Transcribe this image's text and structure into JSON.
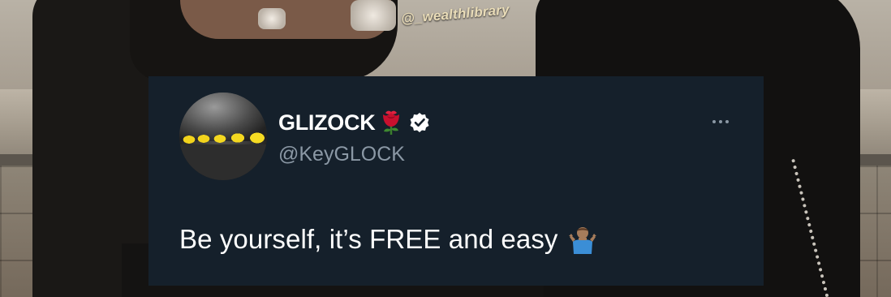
{
  "watermark": "@_wealthlibrary",
  "tweet": {
    "display_name": "GLIZOCK",
    "handle": "@KeyGLOCK",
    "text": "Be yourself, it’s FREE and easy",
    "icons": {
      "name_emoji": "rose-icon",
      "verified": "verified-badge-icon",
      "more": "more-options-icon",
      "text_emoji": "person-shrugging-icon"
    }
  },
  "colors": {
    "card_background": "#15202b",
    "primary_text": "#ffffff",
    "secondary_text": "#8b98a5",
    "watermark_text": "#e9dcb8"
  }
}
